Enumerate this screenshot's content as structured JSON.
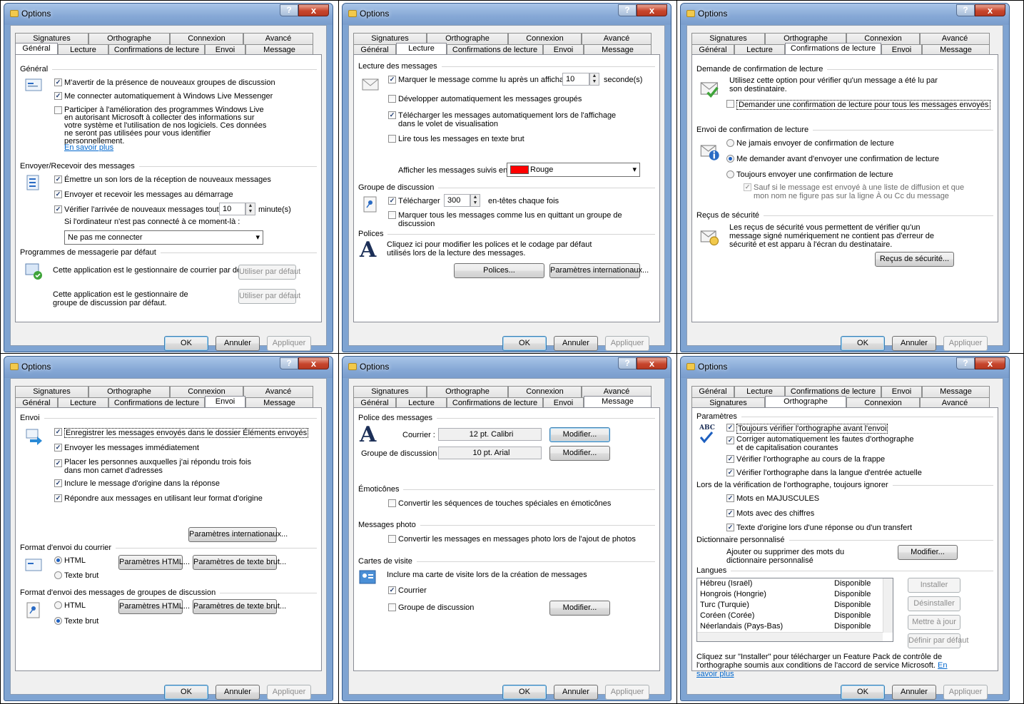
{
  "title": "Options",
  "help_glyph": "?",
  "close_glyph": "x",
  "buttons": {
    "ok": "OK",
    "cancel": "Annuler",
    "apply": "Appliquer"
  },
  "tabs": {
    "general": "Général",
    "reading": "Lecture",
    "receipts": "Confirmations de lecture",
    "send": "Envoi",
    "message": "Message",
    "signatures": "Signatures",
    "spelling": "Orthographe",
    "connection": "Connexion",
    "advanced": "Avancé"
  },
  "general": {
    "sec_general": "Général",
    "notify_groups": "M'avertir de la présence de nouveaux groupes de discussion",
    "connect_messenger": "Me connecter automatiquement à Windows Live Messenger",
    "improvement": "Participer à l'amélioration des programmes Windows Live en autorisant Microsoft à collecter des informations sur votre système et l'utilisation de nos logiciels. Ces données ne seront pas utilisées pour vous identifier personnellement.",
    "learn_more": "En savoir plus",
    "sec_sendrecv": "Envoyer/Recevoir des messages",
    "play_sound": "Émettre un son lors de la réception de nouveaux messages",
    "send_recv_start": "Envoyer et recevoir les messages au démarrage",
    "check_every": "Vérifier l'arrivée de nouveaux messages toutes les",
    "check_value": "10",
    "minutes": "minute(s)",
    "not_connected": "Si l'ordinateur n'est pas connecté à ce moment-là :",
    "connect_option": "Ne pas me connecter",
    "sec_default": "Programmes de messagerie par défaut",
    "default_mail": "Cette application est le gestionnaire de courrier par défaut.",
    "default_news": "Cette application est le gestionnaire de groupe de discussion par défaut.",
    "use_default": "Utiliser par défaut"
  },
  "reading": {
    "sec_read": "Lecture des messages",
    "mark_read": "Marquer le message comme lu après un affichage de",
    "mark_value": "10",
    "seconds": "seconde(s)",
    "expand_groups": "Développer automatiquement les messages groupés",
    "download_preview": "Télécharger les messages automatiquement lors de l'affichage dans le volet de visualisation",
    "plain_text": "Lire tous les messages en texte brut",
    "watched_label": "Afficher les messages suivis en :",
    "watched_color": "Rouge",
    "watched_swatch": "#ff0000",
    "sec_news": "Groupe de discussion",
    "download": "Télécharger",
    "download_value": "300",
    "headers": "en-têtes chaque fois",
    "mark_all_read": "Marquer tous les messages comme lus en quittant un groupe de discussion",
    "sec_fonts": "Polices",
    "fonts_desc": "Cliquez ici pour modifier les polices et le codage par défaut utilisés lors de la lecture des messages.",
    "fonts_btn": "Polices...",
    "intl_btn": "Paramètres internationaux..."
  },
  "receipts": {
    "sec_request": "Demande de confirmation de lecture",
    "request_desc": "Utilisez cette option pour vérifier qu'un message a été lu par son destinataire.",
    "request_all": "Demander une confirmation de lecture pour tous les messages envoyés",
    "sec_return": "Envoi de confirmation de lecture",
    "never": "Ne jamais envoyer de confirmation de lecture",
    "ask": "Me demander avant d'envoyer une confirmation de lecture",
    "always": "Toujours envoyer une confirmation de lecture",
    "except": "Sauf si le message est envoyé à une liste de diffusion et que mon nom ne figure pas sur la ligne À ou Cc du message",
    "sec_secure": "Reçus de sécurité",
    "secure_desc": "Les reçus de sécurité vous permettent de vérifier qu'un message signé numériquement ne contient pas d'erreur de sécurité et est apparu à l'écran du destinataire.",
    "secure_btn": "Reçus de sécurité..."
  },
  "send": {
    "sec_send": "Envoi",
    "save_sent": "Enregistrer les messages envoyés dans le dossier Éléments envoyés",
    "send_immediately": "Envoyer les messages immédiatement",
    "add_replied": "Placer les personnes auxquelles j'ai répondu trois fois dans mon carnet d'adresses",
    "include_original": "Inclure le message d'origine dans la réponse",
    "reply_format": "Répondre aux messages en utilisant leur format d'origine",
    "intl_btn": "Paramètres internationaux...",
    "sec_mail_format": "Format d'envoi du courrier",
    "html": "HTML",
    "plain": "Texte brut",
    "html_settings": "Paramètres HTML...",
    "plain_settings": "Paramètres de texte brut...",
    "sec_news_format": "Format d'envoi des messages de groupes de discussion"
  },
  "message": {
    "sec_font": "Police des messages",
    "mail_label": "Courrier :",
    "mail_font": "12 pt. Calibri",
    "news_label": "Groupe de discussion :",
    "news_font": "10 pt. Arial",
    "modify_btn": "Modifier...",
    "sec_emoticons": "Émoticônes",
    "emoticons": "Convertir les séquences de touches spéciales en émoticônes",
    "sec_photo": "Messages photo",
    "photo": "Convertir les messages en messages photo lors de l'ajout de photos",
    "sec_vcard": "Cartes de visite",
    "vcard_desc": "Inclure ma carte de visite lors de la création de messages",
    "vcard_mail": "Courrier",
    "vcard_news": "Groupe de discussion"
  },
  "spelling": {
    "sec_settings": "Paramètres",
    "abc": "ABC",
    "always_check": "Toujours vérifier l'orthographe avant l'envoi",
    "autocorrect": "Corriger automatiquement les fautes d'orthographe et de capitalisation courantes",
    "as_you_type": "Vérifier l'orthographe au cours de la frappe",
    "input_lang": "Vérifier l'orthographe dans la langue d'entrée actuelle",
    "sec_ignore": "Lors de la vérification de l'orthographe, toujours ignorer",
    "uppercase": "Mots en MAJUSCULES",
    "numbers": "Mots avec des chiffres",
    "original_text": "Texte d'origine lors d'une réponse ou d'un transfert",
    "sec_dict": "Dictionnaire personnalisé",
    "dict_desc": "Ajouter ou supprimer des mots du dictionnaire personnalisé",
    "modify_btn": "Modifier...",
    "sec_langs": "Langues",
    "languages": [
      {
        "name": "Hébreu (Israël)",
        "status": "Disponible"
      },
      {
        "name": "Hongrois (Hongrie)",
        "status": "Disponible"
      },
      {
        "name": "Turc (Turquie)",
        "status": "Disponible"
      },
      {
        "name": "Coréen (Corée)",
        "status": "Disponible"
      },
      {
        "name": "Néerlandais (Pays-Bas)",
        "status": "Disponible"
      }
    ],
    "install": "Installer",
    "uninstall": "Désinstaller",
    "update": "Mettre à jour",
    "set_default": "Définir par défaut",
    "footer": "Cliquez sur \"Installer\" pour télécharger un Feature Pack de contrôle de l'orthographe soumis aux conditions de l'accord de service Microsoft.",
    "learn_more": "En savoir plus"
  }
}
